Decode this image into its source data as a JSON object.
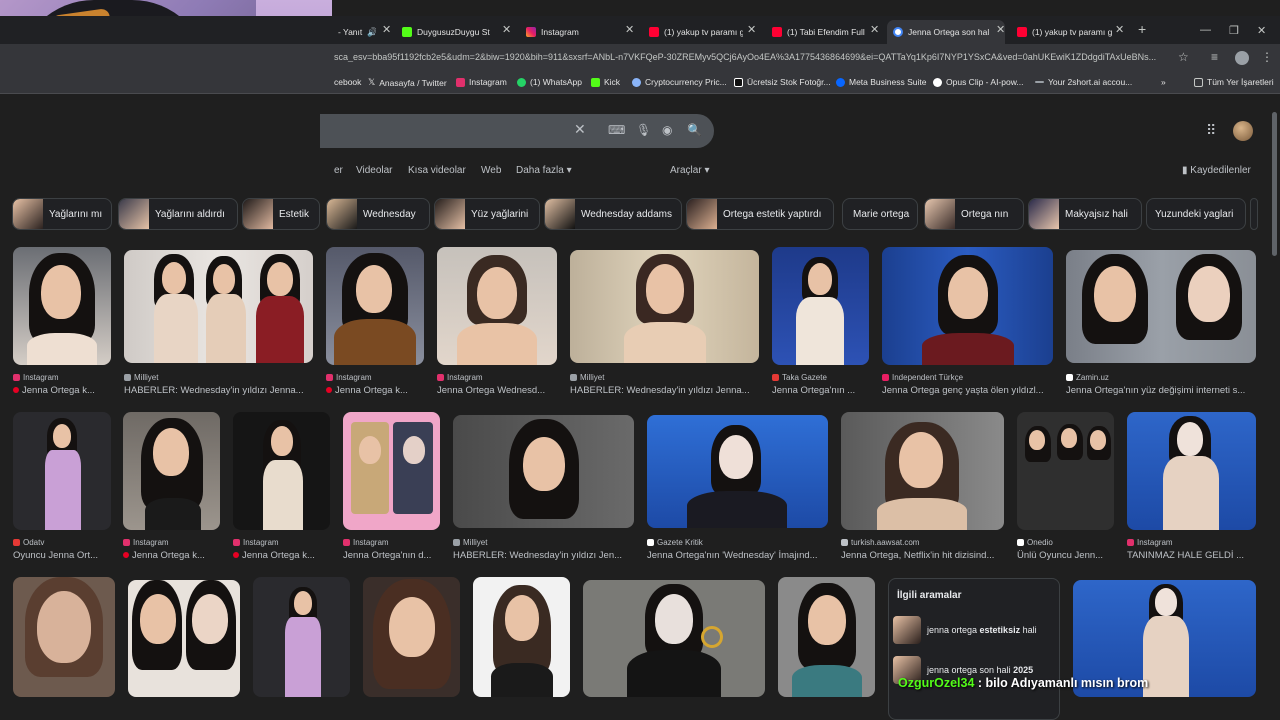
{
  "browser": {
    "tabs": [
      {
        "label": "- Yanıt",
        "icon": "speaker-icon"
      },
      {
        "label": "DuygusuzDuygu St",
        "icon": "kick-icon"
      },
      {
        "label": "Instagram",
        "icon": "instagram-icon"
      },
      {
        "label": "(1) yakup tv paramı g",
        "icon": "youtube-icon"
      },
      {
        "label": "(1) Tabi Efendim Full",
        "icon": "youtube-icon"
      },
      {
        "label": "Jenna Ortega son hal",
        "icon": "google-icon",
        "active": true
      },
      {
        "label": "(1) yakup tv paramı g",
        "icon": "youtube-icon"
      }
    ],
    "url": "sca_esv=bba95f1192fcb2e5&udm=2&biw=1920&bih=911&sxsrf=ANbL-n7VKFQeP-30ZREMyv5QCj6AyOo4EA%3A1775436864699&ei=QATTaYq1Kp6I7NYP1YSxCA&ved=0ahUKEwiK1ZDdgdiTAxUeBNs...",
    "bookmarks": [
      "cebook",
      "Anasayfa / Twitter",
      "Instagram",
      "(1) WhatsApp",
      "Kick",
      "Cryptocurrency Pric...",
      "Ücretsiz Stok Fotoğr...",
      "Meta Business Suite",
      "Opus Clip - AI-pow...",
      "Your 2short.ai accou..."
    ],
    "all_bookmarks": "Tüm Yer İşaretleri"
  },
  "search": {
    "nav": [
      "er",
      "Videolar",
      "Kısa videolar",
      "Web",
      "Daha fazla",
      "Araçlar"
    ],
    "saved": "Kaydedilenler",
    "chips": [
      "Yağlarını mı",
      "Yağlarını aldırdı",
      "Estetik",
      "Wednesday",
      "Yüz yağlarini",
      "Wednesday addams",
      "Ortega estetik yaptırdı",
      "Marie ortega",
      "Ortega nın",
      "Makyajsız hali",
      "Yuzundeki yaglari"
    ]
  },
  "results": [
    {
      "source": "Instagram",
      "title": "Jenna Ortega k..."
    },
    {
      "source": "Milliyet",
      "title": "HABERLER: Wednesday'in yıldızı Jenna..."
    },
    {
      "source": "Instagram",
      "title": "Jenna Ortega k..."
    },
    {
      "source": "Instagram",
      "title": "Jenna Ortega Wednesd..."
    },
    {
      "source": "Milliyet",
      "title": "HABERLER: Wednesday'in yıldızı Jenna..."
    },
    {
      "source": "Taka Gazete",
      "title": "Jenna Ortega'nın ..."
    },
    {
      "source": "Independent Türkçe",
      "title": "Jenna Ortega genç yaşta ölen yıldızl..."
    },
    {
      "source": "Zamin.uz",
      "title": "Jenna Ortega'nın yüz değişimi interneti s..."
    },
    {
      "source": "Odatv",
      "title": "Oyuncu Jenna Ort..."
    },
    {
      "source": "Instagram",
      "title": "Jenna Ortega k..."
    },
    {
      "source": "Instagram",
      "title": "Jenna Ortega k..."
    },
    {
      "source": "Instagram",
      "title": "Jenna Ortega'nın d..."
    },
    {
      "source": "Milliyet",
      "title": "HABERLER: Wednesday'in yıldızı Jen..."
    },
    {
      "source": "Gazete Kritik",
      "title": "Jenna Ortega'nın 'Wednesday' İmajınd..."
    },
    {
      "source": "turkish.aawsat.com",
      "title": "Jenna Ortega, Netflix'in hit dizisind..."
    },
    {
      "source": "Onedio",
      "title": "Ünlü Oyuncu Jenn..."
    },
    {
      "source": "Instagram",
      "title": "TANINMAZ HALE GELDİ ..."
    }
  ],
  "related": {
    "title": "İlgili aramalar",
    "items": [
      {
        "prefix": "jenna ortega ",
        "bold": "estetiksiz",
        "suffix": " hali"
      },
      {
        "prefix": "jenna ortega son hali ",
        "bold": "2025",
        "suffix": ""
      }
    ]
  },
  "chat": {
    "user": "OzgurOzel34",
    "message": " : bilo Adıyamanlı mısın brom"
  }
}
